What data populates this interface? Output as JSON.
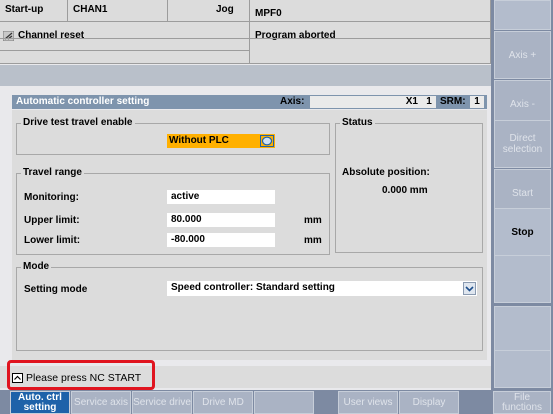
{
  "header": {
    "mode": "Start-up",
    "channel": "CHAN1",
    "op_mode": "Jog",
    "program": "MPF0",
    "channel_status": "Channel reset",
    "program_status": "Program aborted"
  },
  "panel": {
    "title": "Automatic controller setting",
    "axis_label": "Axis:",
    "axis_name": "X1",
    "axis_number": "1",
    "srm_label": "SRM:",
    "srm_value": "1",
    "drive_test": {
      "title": "Drive test travel enable",
      "value": "Without PLC"
    },
    "travel_range": {
      "title": "Travel range",
      "monitoring_label": "Monitoring:",
      "monitoring_value": "active",
      "upper_label": "Upper limit:",
      "upper_value": "80.000",
      "upper_unit": "mm",
      "lower_label": "Lower limit:",
      "lower_value": "-80.000",
      "lower_unit": "mm"
    },
    "status": {
      "title": "Status",
      "position_label": "Absolute position:",
      "position_value": "0.000 mm"
    },
    "mode": {
      "title": "Mode",
      "setting_label": "Setting mode",
      "setting_value": "Speed controller: Standard setting"
    }
  },
  "status_message": "Please press NC START",
  "right_softkeys": [
    "Axis +",
    "Axis -",
    "Direct selection",
    "Start",
    "Stop",
    "",
    "",
    ""
  ],
  "bottom_softkeys": [
    "Auto. ctrl setting",
    "Service axis",
    "Service drive",
    "Drive MD",
    "",
    "User views",
    "Display",
    "File functions"
  ],
  "colors": {
    "softkey_bg": "#aab3c4",
    "active_softkey": "#1e62a9",
    "title_bar": "#7e94ad",
    "highlight": "#e0141f",
    "toggle": "#ffb000"
  }
}
